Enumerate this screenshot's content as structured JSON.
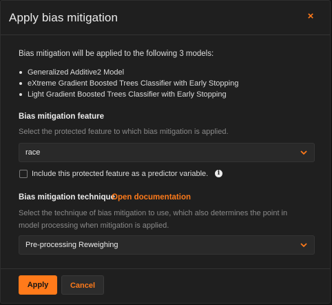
{
  "dialog": {
    "title": "Apply bias mitigation",
    "close_glyph": "×"
  },
  "intro": {
    "text": "Bias mitigation will be applied to the following 3 models:",
    "models": [
      "Generalized Additive2 Model",
      "eXtreme Gradient Boosted Trees Classifier with Early Stopping",
      "Light Gradient Boosted Trees Classifier with Early Stopping"
    ]
  },
  "feature": {
    "label": "Bias mitigation feature",
    "hint": "Select the protected feature to which bias mitigation is applied.",
    "selected": "race",
    "checkbox_label": "Include this protected feature as a predictor variable.",
    "checkbox_checked": false
  },
  "technique": {
    "label": "Bias mitigation technique",
    "doc_link": "Open documentation",
    "hint": "Select the technique of bias mitigation to use, which also determines the point in model processing when mitigation is applied.",
    "selected": "Pre-processing Reweighing"
  },
  "footer": {
    "apply_label": "Apply",
    "cancel_label": "Cancel"
  },
  "colors": {
    "accent": "#ff7a1a",
    "background": "#1f1f1f",
    "field": "#292929"
  },
  "icons": {
    "close": "close-icon",
    "chevron": "chevron-down-icon",
    "info": "info-icon"
  }
}
